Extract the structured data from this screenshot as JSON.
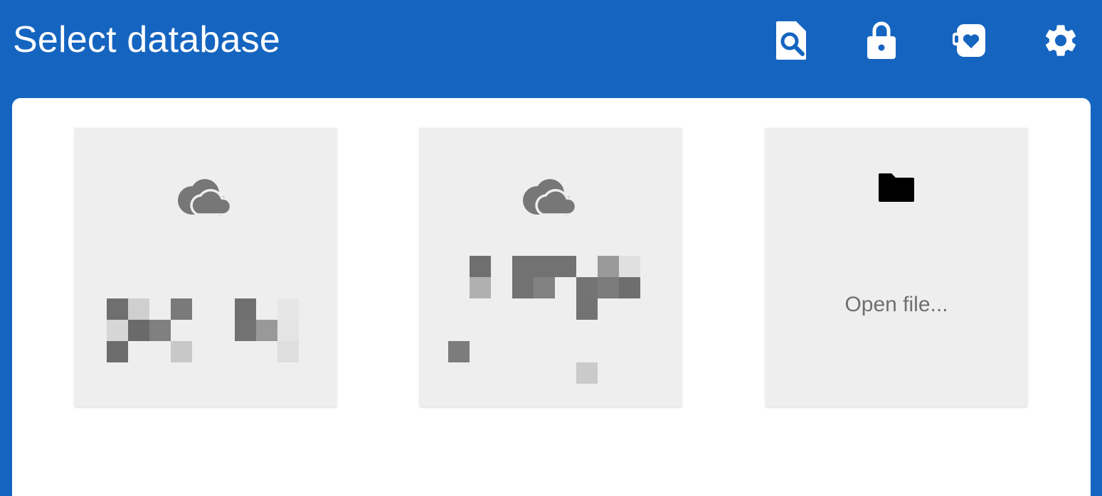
{
  "appbar": {
    "title": "Select database",
    "actions": [
      {
        "name": "find-icon"
      },
      {
        "name": "lock-icon"
      },
      {
        "name": "contribute-icon"
      },
      {
        "name": "settings-icon"
      }
    ]
  },
  "colors": {
    "primary": "#1565C0",
    "surface": "#ffffff",
    "tile": "#eeeeee",
    "tile_icon": "#777777",
    "tile_text": "#6f6f6f"
  },
  "databases": [
    {
      "icon": "cloud-icon",
      "label_redacted": true
    },
    {
      "icon": "cloud-icon",
      "label_redacted": true
    }
  ],
  "open_file": {
    "icon": "folder-icon",
    "label": "Open file..."
  }
}
